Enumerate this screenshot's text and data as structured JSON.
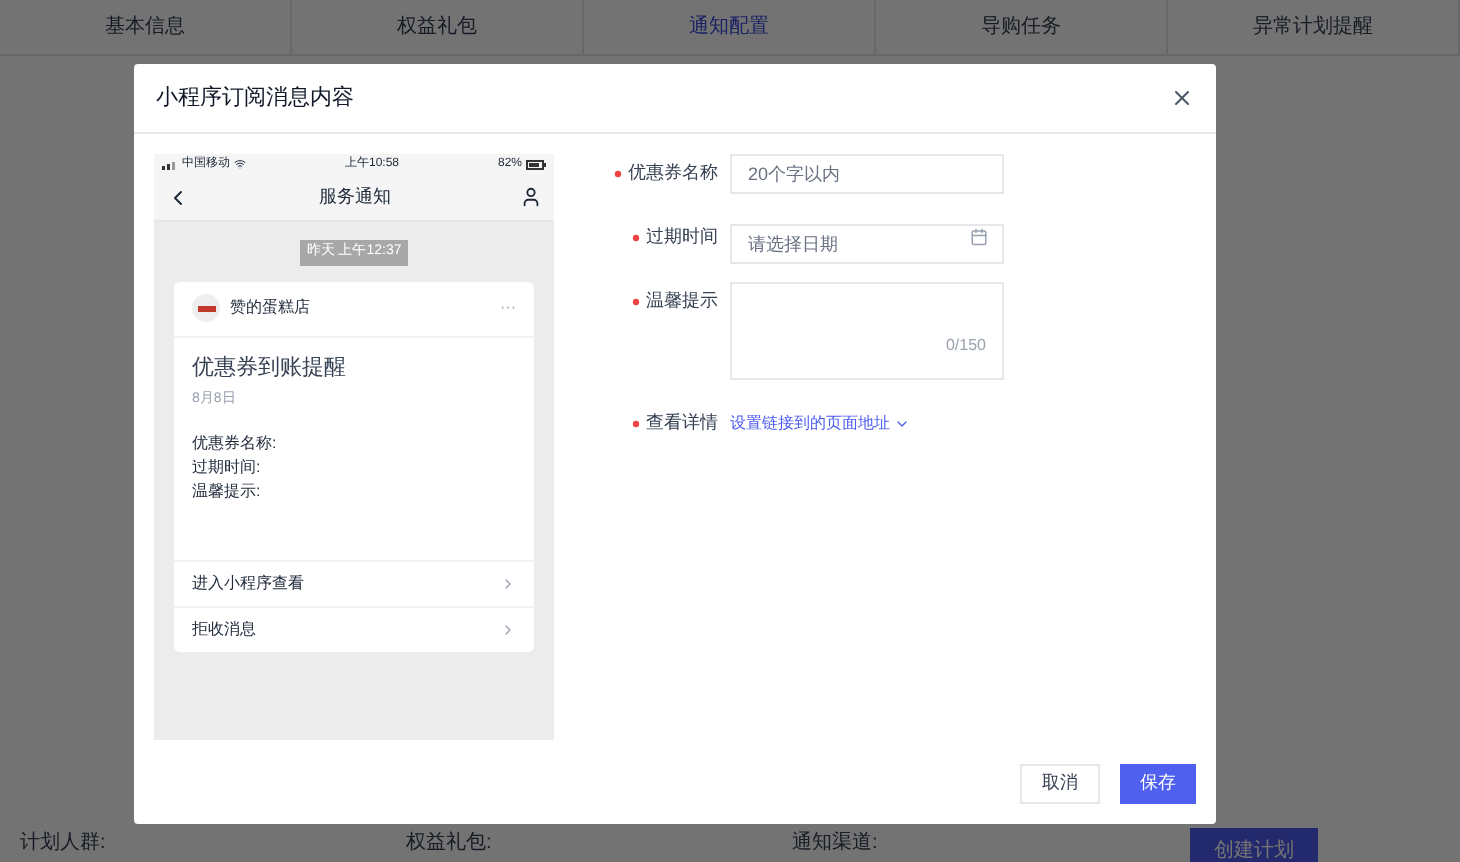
{
  "tabs": [
    {
      "label": "基本信息",
      "selected": false
    },
    {
      "label": "权益礼包",
      "selected": false
    },
    {
      "label": "通知配置",
      "selected": true
    },
    {
      "label": "导购任务",
      "selected": false
    },
    {
      "label": "异常计划提醒",
      "selected": false
    }
  ],
  "bottom_fields": [
    "计划人群:",
    "权益礼包:",
    "通知渠道:"
  ],
  "create_button": "创建计划",
  "dialog": {
    "title": "小程序订阅消息内容",
    "phone": {
      "carrier": "中国移动",
      "time": "上午10:58",
      "battery": "82%",
      "nav_title": "服务通知",
      "timestamp": "昨天 上午12:37",
      "store": "赞的蛋糕店",
      "more": "···",
      "message_title": "优惠券到账提醒",
      "date": "8月8日",
      "lines": [
        "优惠券名称:",
        "过期时间:",
        "温馨提示:"
      ],
      "actions": [
        "进入小程序查看",
        "拒收消息"
      ]
    },
    "fields": [
      {
        "kind": "input",
        "label": "优惠券名称",
        "required": true,
        "placeholder": "20个字以内"
      },
      {
        "kind": "date",
        "label": "过期时间",
        "required": true,
        "placeholder": "请选择日期"
      },
      {
        "kind": "textarea",
        "label": "温馨提示",
        "required": true,
        "counter": "0/150"
      },
      {
        "kind": "link",
        "label": "查看详情",
        "required": true,
        "link": "设置链接到的页面地址"
      }
    ],
    "buttons": {
      "cancel": "取消",
      "save": "保存"
    }
  }
}
